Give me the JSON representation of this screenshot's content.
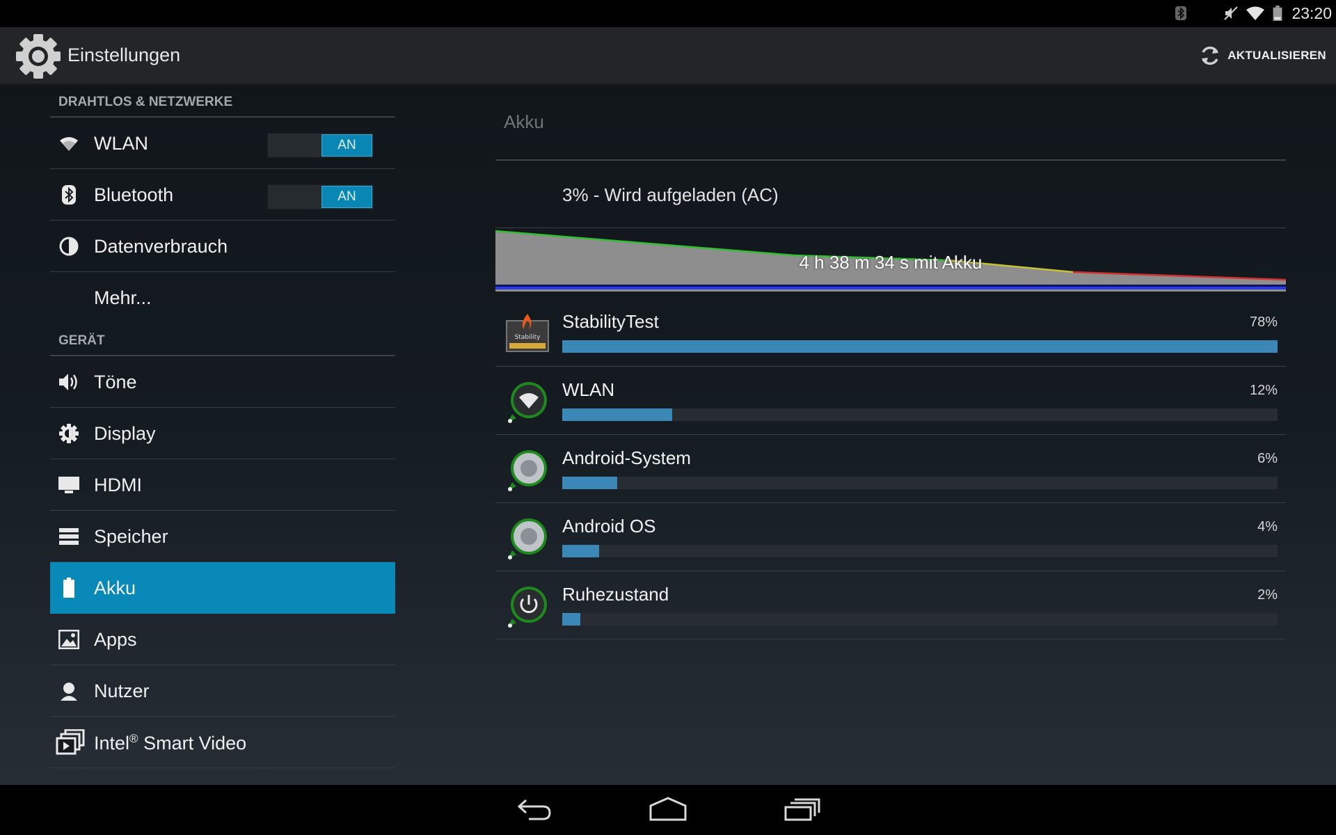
{
  "status_bar": {
    "time": "23:20",
    "icons": [
      "bluetooth-icon",
      "mute-icon",
      "wifi-icon",
      "battery-icon"
    ]
  },
  "action_bar": {
    "title": "Einstellungen",
    "refresh_label": "AKTUALISIEREN"
  },
  "sidebar": {
    "categories": [
      "DRAHTLOS & NETZWERKE",
      "GERÄT"
    ],
    "items": [
      {
        "label": "WLAN",
        "icon": "wifi-icon",
        "toggle": "AN"
      },
      {
        "label": "Bluetooth",
        "icon": "bluetooth-icon",
        "toggle": "AN"
      },
      {
        "label": "Datenverbrauch",
        "icon": "data-usage-icon"
      },
      {
        "label": "Mehr..."
      },
      {
        "label": "Töne",
        "icon": "speaker-icon"
      },
      {
        "label": "Display",
        "icon": "brightness-icon"
      },
      {
        "label": "HDMI",
        "icon": "monitor-icon"
      },
      {
        "label": "Speicher",
        "icon": "storage-icon"
      },
      {
        "label": "Akku",
        "icon": "battery-icon",
        "active": true
      },
      {
        "label": "Apps",
        "icon": "apps-icon"
      },
      {
        "label": "Nutzer",
        "icon": "user-icon"
      },
      {
        "label": "Intel",
        "label_suffix": "Smart Video",
        "sup": "®",
        "icon": "smart-video-icon"
      }
    ]
  },
  "main": {
    "title": "Akku",
    "battery_status": "3% - Wird aufgeladen (AC)",
    "graph_label": "4 h 38 m 34 s mit Akku",
    "apps": [
      {
        "name": "StabilityTest",
        "percent": "78%",
        "value": 78,
        "icon": "stabilitytest-app-icon"
      },
      {
        "name": "WLAN",
        "percent": "12%",
        "value": 12,
        "icon": "wifi-usage-icon"
      },
      {
        "name": "Android-System",
        "percent": "6%",
        "value": 6,
        "icon": "android-system-icon"
      },
      {
        "name": "Android OS",
        "percent": "4%",
        "value": 4,
        "icon": "android-os-icon"
      },
      {
        "name": "Ruhezustand",
        "percent": "2%",
        "value": 2,
        "icon": "power-icon"
      }
    ]
  },
  "nav_bar": {
    "buttons": [
      "back-button",
      "home-button",
      "recents-button"
    ]
  },
  "colors": {
    "accent": "#0889b8",
    "bar": "#3a87b8",
    "action_bar": "#232527"
  }
}
